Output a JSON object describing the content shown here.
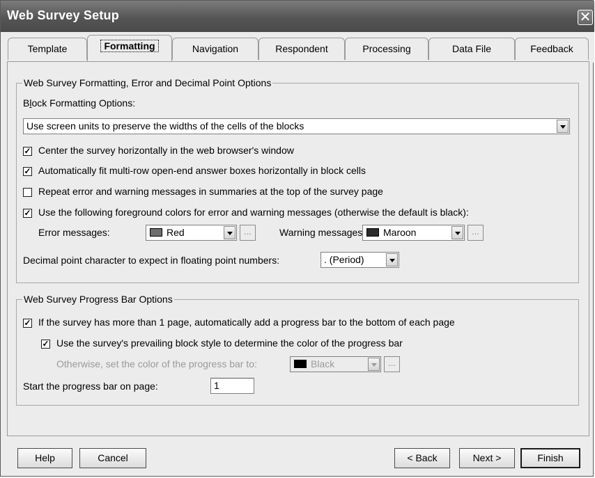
{
  "window": {
    "title": "Web Survey Setup"
  },
  "tabs": [
    {
      "label": "Template"
    },
    {
      "label": "Formatting"
    },
    {
      "label": "Navigation"
    },
    {
      "label": "Respondent"
    },
    {
      "label": "Processing"
    },
    {
      "label": "Data File"
    },
    {
      "label": "Feedback"
    }
  ],
  "formatting_group": {
    "title": "Web Survey Formatting, Error and Decimal Point Options",
    "block_label": "Block Formatting Options:",
    "block_value": "Use screen units to preserve the widths of the cells of the blocks",
    "options": [
      {
        "label": "Center the survey horizontally in the web browser's window",
        "checked": true
      },
      {
        "label": "Automatically fit multi-row open-end answer boxes horizontally in block cells",
        "checked": true
      },
      {
        "label": "Repeat error and warning messages in summaries at the top of the survey page",
        "checked": false
      },
      {
        "label": "Use the following foreground colors for error and warning messages (otherwise the default is black):",
        "checked": true
      }
    ],
    "error_label": "Error messages:",
    "error_color": {
      "name": "Red",
      "swatch": "#6e6e6e"
    },
    "warning_label": "Warning messages:",
    "warning_color": {
      "name": "Maroon",
      "swatch": "#2a2a2a"
    },
    "ellipsis": "...",
    "decimal_label": "Decimal point character to expect in floating point numbers:",
    "decimal_value": ". (Period)"
  },
  "progress_group": {
    "title": "Web Survey Progress Bar Options",
    "add_bar_label": "If the survey has more than 1 page, automatically add a progress bar to the bottom of each page",
    "add_bar_checked": true,
    "prevailing_label": "Use the survey's prevailing block style to determine the color of the progress bar",
    "prevailing_checked": true,
    "otherwise_label": "Otherwise, set the color of the progress bar to:",
    "bar_color": {
      "name": "Black",
      "swatch": "#000000"
    },
    "start_label": "Start the progress bar on page:",
    "start_value": "1"
  },
  "buttons": {
    "help": "Help",
    "cancel": "Cancel",
    "back": "< Back",
    "next": "Next >",
    "finish": "Finish"
  }
}
